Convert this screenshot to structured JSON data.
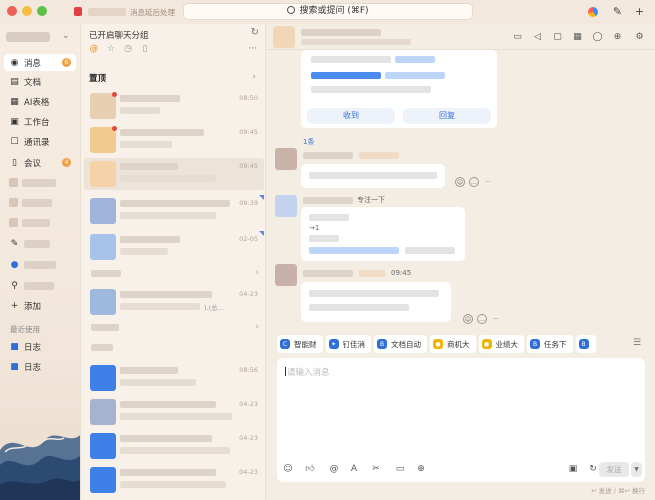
{
  "window": {
    "notice_text": "消息延后处理",
    "search_placeholder": "搜索或提问 (⌘F)"
  },
  "sidebar": {
    "items": [
      {
        "label": "消息",
        "icon": "message-icon",
        "badge": "6"
      },
      {
        "label": "文档",
        "icon": "document-icon"
      },
      {
        "label": "AI表格",
        "icon": "ai-table-icon"
      },
      {
        "label": "工作台",
        "icon": "workbench-icon"
      },
      {
        "label": "通讯录",
        "icon": "contacts-icon"
      },
      {
        "label": "会议",
        "icon": "meeting-icon",
        "badge": "4"
      }
    ],
    "add_label": "添加",
    "recent_label": "最近使用",
    "recent_items": [
      "日志",
      "日志"
    ]
  },
  "chatlist": {
    "title": "已开启聊天分组",
    "pinned_label": "置顶",
    "rows": [
      {
        "time": "08:50"
      },
      {
        "time": "09:45"
      },
      {
        "time": "09:45"
      },
      {
        "time": "09:39"
      },
      {
        "time": "02-05"
      },
      {
        "time": ""
      },
      {
        "time": "04-23",
        "file_hint": ").(总..."
      },
      {
        "time": ""
      },
      {
        "time": "08:56"
      },
      {
        "time": "04-23"
      },
      {
        "time": "04-23"
      },
      {
        "time": "04-23"
      }
    ]
  },
  "chat": {
    "card_buttons": {
      "received": "收到",
      "reply": "回复"
    },
    "reply_count": "1条",
    "follow_label": "专注一下",
    "arrow_text": "→1",
    "time_label": "09:45"
  },
  "quick_apps": [
    {
      "label": "智能财",
      "color": "#2e6fd8"
    },
    {
      "label": "钉佳消",
      "color": "#2e6fd8"
    },
    {
      "label": "文档自动",
      "color": "#2e6fd8"
    },
    {
      "label": "商机大",
      "color": "#f0b400"
    },
    {
      "label": "业绩大",
      "color": "#f0b400"
    },
    {
      "label": "任务下",
      "color": "#2e6fd8"
    }
  ],
  "input": {
    "placeholder": "请输入消息",
    "send_label": "发送",
    "hint": "↩ 发送 / ⌘↩ 换行"
  }
}
